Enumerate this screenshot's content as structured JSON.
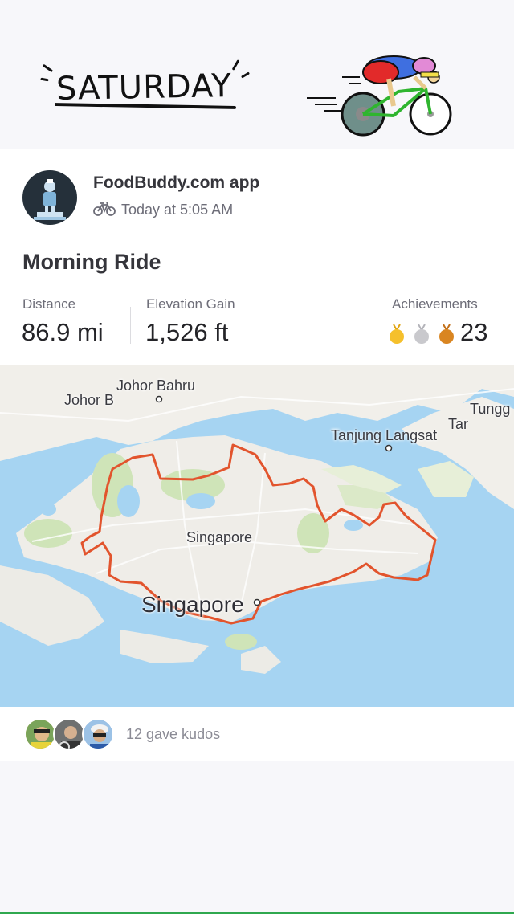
{
  "sticker": {
    "day_text": "SATURDAY"
  },
  "post": {
    "athlete_name": "FoodBuddy.com app",
    "timestamp": "Today at 5:05 AM",
    "activity_icon": "bike-icon",
    "title": "Morning Ride"
  },
  "stats": {
    "distance_label": "Distance",
    "distance_value": "86.9 mi",
    "elevation_label": "Elevation Gain",
    "elevation_value": "1,526 ft",
    "achievements_label": "Achievements",
    "achievements_count": "23",
    "medal_colors": [
      "#f5c02c",
      "#c9c9cd",
      "#d98521"
    ]
  },
  "map": {
    "route_color": "#e2542d",
    "labels": {
      "johor_bahru": "Johor Bahru",
      "johor_b": "Johor B",
      "tungg": "Tungg",
      "tar": "Tar",
      "tanjung_langsat": "Tanjung Langsat",
      "singapore_region": "Singapore",
      "singapore_city": "Singapore"
    }
  },
  "kudos": {
    "text": "12 gave kudos"
  }
}
